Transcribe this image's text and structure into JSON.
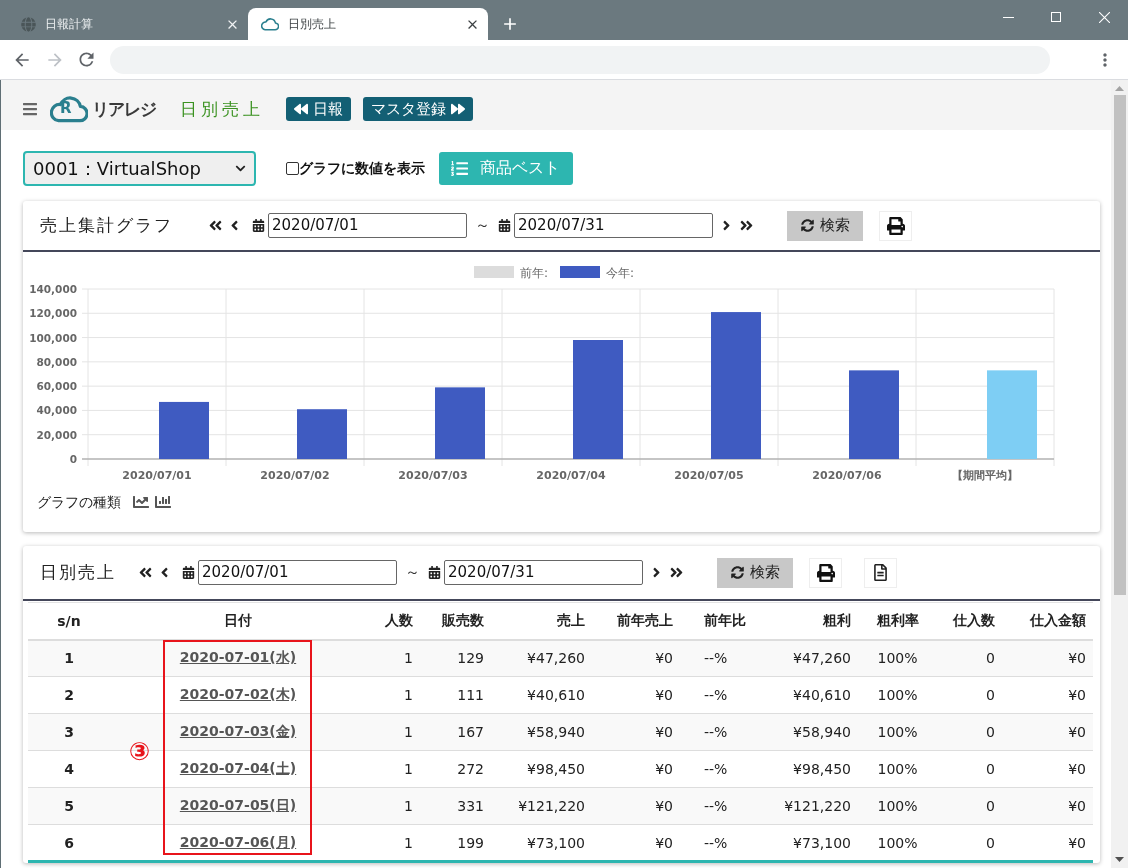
{
  "browser": {
    "tabs": [
      {
        "kind": "globe",
        "title": "日報計算",
        "selected": false
      },
      {
        "kind": "logo",
        "title": "日別売上",
        "selected": true
      }
    ]
  },
  "header": {
    "logo": {
      "mark": "R",
      "text": "リアレジ"
    },
    "page_title": "日別売上",
    "nav_buttons": [
      {
        "kind": "back",
        "label": "日報"
      },
      {
        "kind": "forward",
        "label": "マスタ登録"
      }
    ]
  },
  "controls": {
    "shop_select": {
      "value": "0001：VirtualShop"
    },
    "show_values": {
      "label": "グラフに数値を表示",
      "checked": false
    },
    "best_button": {
      "label": "商品ベスト"
    }
  },
  "graph_card": {
    "title": "売上集計グラフ",
    "date_from": "2020/07/01",
    "range_separator": "～",
    "date_to": "2020/07/31",
    "search_button": "検索",
    "tools": [
      {
        "kind": "print"
      }
    ],
    "chart_data": {
      "type": "bar",
      "grid": true,
      "categories": [
        "2020/07/01",
        "2020/07/02",
        "2020/07/03",
        "2020/07/04",
        "2020/07/05",
        "2020/07/06",
        "【期間平均】"
      ],
      "series": [
        {
          "name": "前年:",
          "color": "#dcdcdc",
          "values": [
            0,
            0,
            0,
            0,
            0,
            0,
            0
          ]
        },
        {
          "name": "今年:",
          "color": "#3f5bc1",
          "values": [
            47000,
            41000,
            59000,
            98000,
            121000,
            73000,
            null
          ]
        },
        {
          "color": "#7ecef4",
          "values": [
            null,
            null,
            null,
            null,
            null,
            null,
            73000
          ]
        }
      ],
      "ylim": [
        0,
        140000
      ],
      "yticks": [
        {
          "value": 0,
          "label": "0"
        },
        {
          "value": 20000,
          "label": "20,000"
        },
        {
          "value": 40000,
          "label": "40,000"
        },
        {
          "value": 60000,
          "label": "60,000"
        },
        {
          "value": 80000,
          "label": "80,000"
        },
        {
          "value": 100000,
          "label": "100,000"
        },
        {
          "value": 120000,
          "label": "120,000"
        },
        {
          "value": 140000,
          "label": "140,000"
        }
      ]
    },
    "chart_type_label": "グラフの種類"
  },
  "sales_card": {
    "title": "日別売上",
    "date_from": "2020/07/01",
    "range_separator": "～",
    "date_to": "2020/07/31",
    "search_button": "検索",
    "tools": [
      {
        "kind": "print"
      },
      {
        "kind": "document"
      }
    ],
    "table": {
      "columns": [
        "s/n",
        "日付",
        "人数",
        "販売数",
        "売上",
        "前年売上",
        "前年比",
        "粗利",
        "粗利率",
        "仕入数",
        "仕入金額"
      ],
      "rows": [
        [
          "1",
          "2020-07-01(水)",
          "1",
          "129",
          "¥47,260",
          "¥0",
          "--%",
          "¥47,260",
          "100%",
          "0",
          "¥0"
        ],
        [
          "2",
          "2020-07-02(木)",
          "1",
          "111",
          "¥40,610",
          "¥0",
          "--%",
          "¥40,610",
          "100%",
          "0",
          "¥0"
        ],
        [
          "3",
          "2020-07-03(金)",
          "1",
          "167",
          "¥58,940",
          "¥0",
          "--%",
          "¥58,940",
          "100%",
          "0",
          "¥0"
        ],
        [
          "4",
          "2020-07-04(土)",
          "1",
          "272",
          "¥98,450",
          "¥0",
          "--%",
          "¥98,450",
          "100%",
          "0",
          "¥0"
        ],
        [
          "5",
          "2020-07-05(日)",
          "1",
          "331",
          "¥121,220",
          "¥0",
          "--%",
          "¥121,220",
          "100%",
          "0",
          "¥0"
        ],
        [
          "6",
          "2020-07-06(月)",
          "1",
          "199",
          "¥73,100",
          "¥0",
          "--%",
          "¥73,100",
          "100%",
          "0",
          "¥0"
        ]
      ]
    },
    "annotation": {
      "label": "③"
    }
  }
}
